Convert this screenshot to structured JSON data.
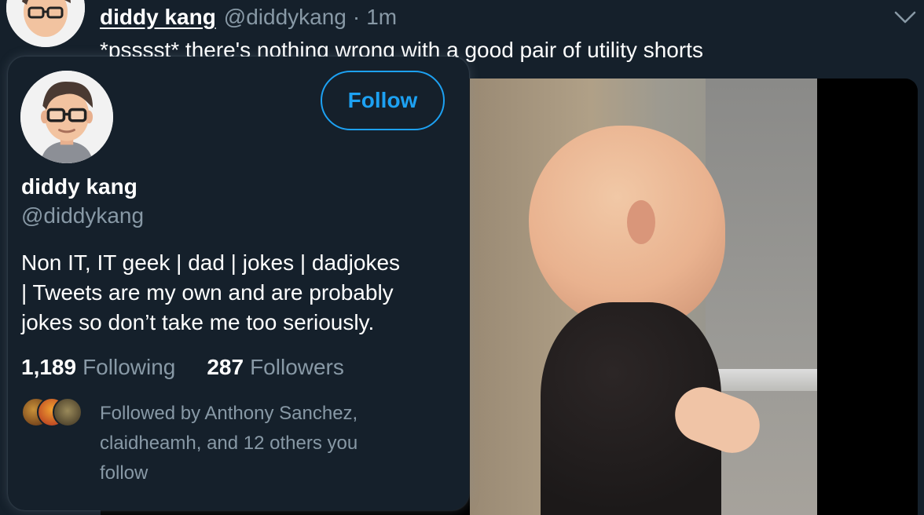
{
  "tweet": {
    "author_name": "diddy kang",
    "author_handle": "@diddykang",
    "separator": "·",
    "time": "1m",
    "text": "*psssst* there's nothing wrong with a good pair of utility shorts",
    "more_icon": "chevron-down-icon"
  },
  "hover_card": {
    "name": "diddy kang",
    "handle": "@diddykang",
    "follow_label": "Follow",
    "bio_lines": [
      "Non IT, IT geek | dad | jokes | dadjokes",
      "|  Tweets are my own and are probably",
      "jokes so don’t take me too seriously."
    ],
    "following_count": "1,189",
    "following_label": "Following",
    "followers_count": "287",
    "followers_label": "Followers",
    "mutual_lines": [
      "Followed by Anthony Sanchez,",
      "claidheamh, and 12 others you",
      "follow"
    ]
  },
  "colors": {
    "background": "#15202b",
    "accent": "#1da1f2",
    "secondary_text": "#8899a6"
  }
}
